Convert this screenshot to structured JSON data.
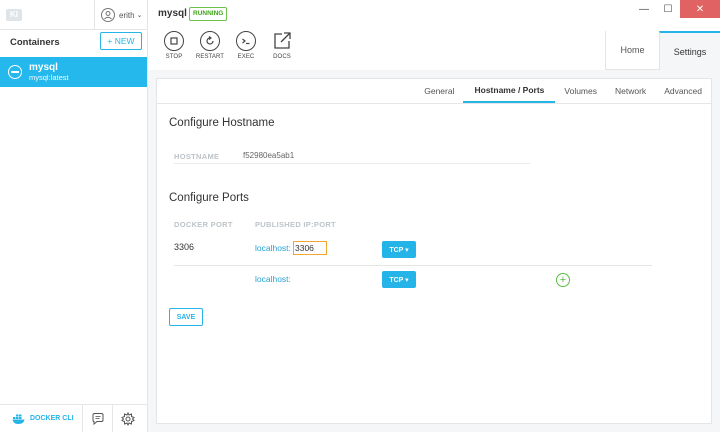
{
  "sidebar": {
    "logo": "KI",
    "user_name": "erith",
    "title": "Containers",
    "new_label": "+ NEW",
    "container": {
      "name": "mysql",
      "image": "mysql:latest"
    },
    "docker_cli_label": "DOCKER CLI"
  },
  "topbar": {
    "container_name": "mysql",
    "status": "RUNNING",
    "actions": [
      "STOP",
      "RESTART",
      "EXEC",
      "DOCS"
    ],
    "view_tabs": [
      "Home",
      "Settings"
    ]
  },
  "settings_tabs": [
    "General",
    "Hostname / Ports",
    "Volumes",
    "Network",
    "Advanced"
  ],
  "hostname": {
    "heading": "Configure Hostname",
    "label": "HOSTNAME",
    "value": "f52980ea5ab1"
  },
  "ports": {
    "heading": "Configure Ports",
    "col_docker": "DOCKER PORT",
    "col_published": "PUBLISHED IP:PORT",
    "rows": [
      {
        "docker_port": "3306",
        "host": "localhost:",
        "published_port": "3306",
        "protocol": "TCP ▾"
      },
      {
        "docker_port": "",
        "host": "localhost:",
        "published_port": "",
        "protocol": "TCP ▾"
      }
    ],
    "add_symbol": "+"
  },
  "save_label": "SAVE",
  "colors": {
    "accent": "#25b4e8",
    "running": "#3fa61a",
    "focus": "#f0a830",
    "close": "#e06262"
  }
}
